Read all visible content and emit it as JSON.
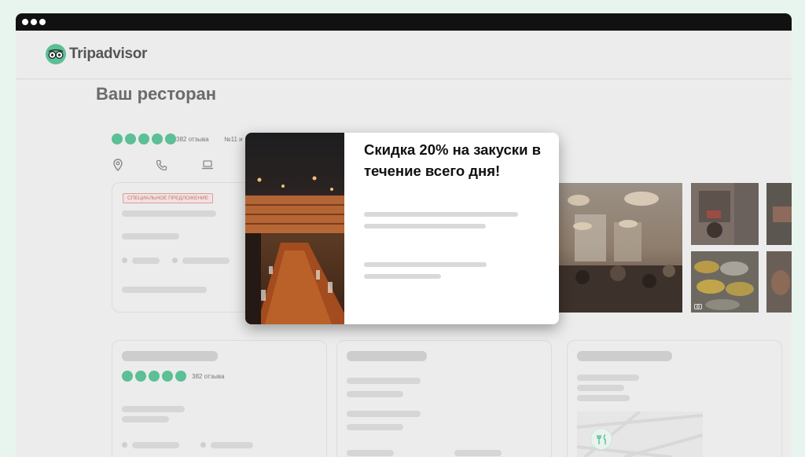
{
  "app": {
    "logo_text": "Tripadvisor",
    "logo_icon": "tripadvisor-owl-icon",
    "accent_color": "#5cbf95"
  },
  "restaurant": {
    "title": "Ваш ресторан",
    "rating_stars": 5,
    "reviews": "382 отзыва",
    "rank": "№11 и"
  },
  "actions": {
    "icons": [
      "location-pin-icon",
      "phone-icon",
      "laptop-icon"
    ]
  },
  "offer": {
    "badge": "СПЕЦИАЛЬНОЕ ПРЕДЛОЖЕНИЕ"
  },
  "popup": {
    "title": "Скидка 20% на закуски в течение всего дня!"
  },
  "bottom_card": {
    "reviews": "382 отзыва"
  }
}
